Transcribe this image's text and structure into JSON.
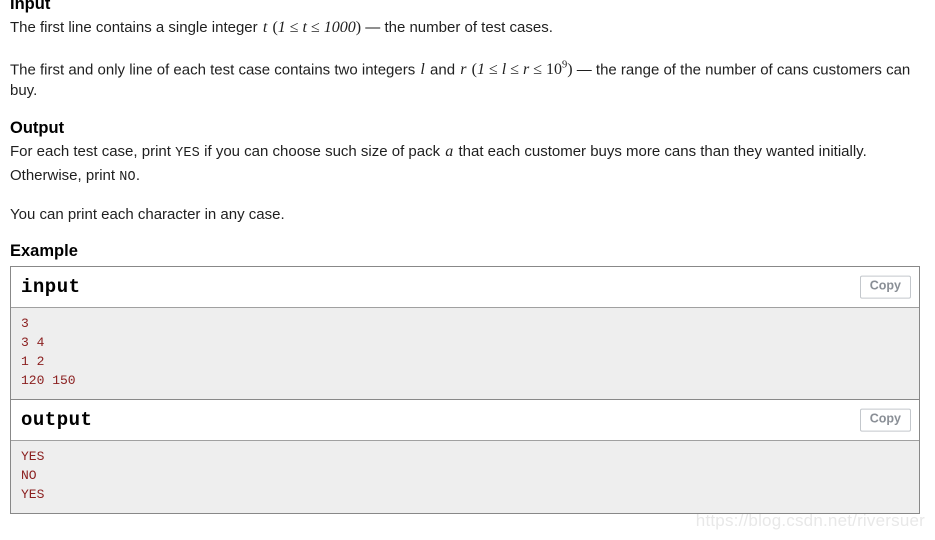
{
  "input_section": {
    "heading": "Input",
    "paragraph1": {
      "before": "The first line contains a single integer",
      "var": "t",
      "expr_open": "(",
      "expr": "1 ≤ t ≤ 1000",
      "expr_close": ")",
      "after": "— the number of test cases.",
      "range_lo": "1",
      "range_hi": "1000",
      "relation": "≤"
    },
    "paragraph2": {
      "before": "The first and only line of each test case contains two integers",
      "var1": "l",
      "conj": "and",
      "var2": "r",
      "expr": "1 ≤ l ≤ r ≤ 10",
      "exponent": "9",
      "after": "— the range of the number of cans customers can buy."
    }
  },
  "output_section": {
    "heading": "Output",
    "paragraph1_part1": "For each test case, print",
    "yes_token": "YES",
    "paragraph1_part2": "if you can choose such size of pack",
    "pack_var": "a",
    "paragraph1_part3": "that each customer buys more cans than they wanted initially. Otherwise, print",
    "no_token": "NO",
    "paragraph1_part4": ".",
    "paragraph2": "You can print each character in any case."
  },
  "example_section": {
    "heading": "Example",
    "blocks": [
      {
        "title": "input",
        "copy_label": "Copy",
        "content": "3\n3 4\n1 2\n120 150"
      },
      {
        "title": "output",
        "copy_label": "Copy",
        "content": "YES\nNO\nYES"
      }
    ]
  },
  "watermark": {
    "text": "https://blog.csdn.net/riversuer"
  },
  "colors": {
    "sample_text": "#8b2020",
    "sample_bg": "#eeeeee",
    "border": "#888888",
    "copy_text": "#8a8f96",
    "body_text": "#1f1f1f",
    "watermark": "#e8e8e8"
  }
}
